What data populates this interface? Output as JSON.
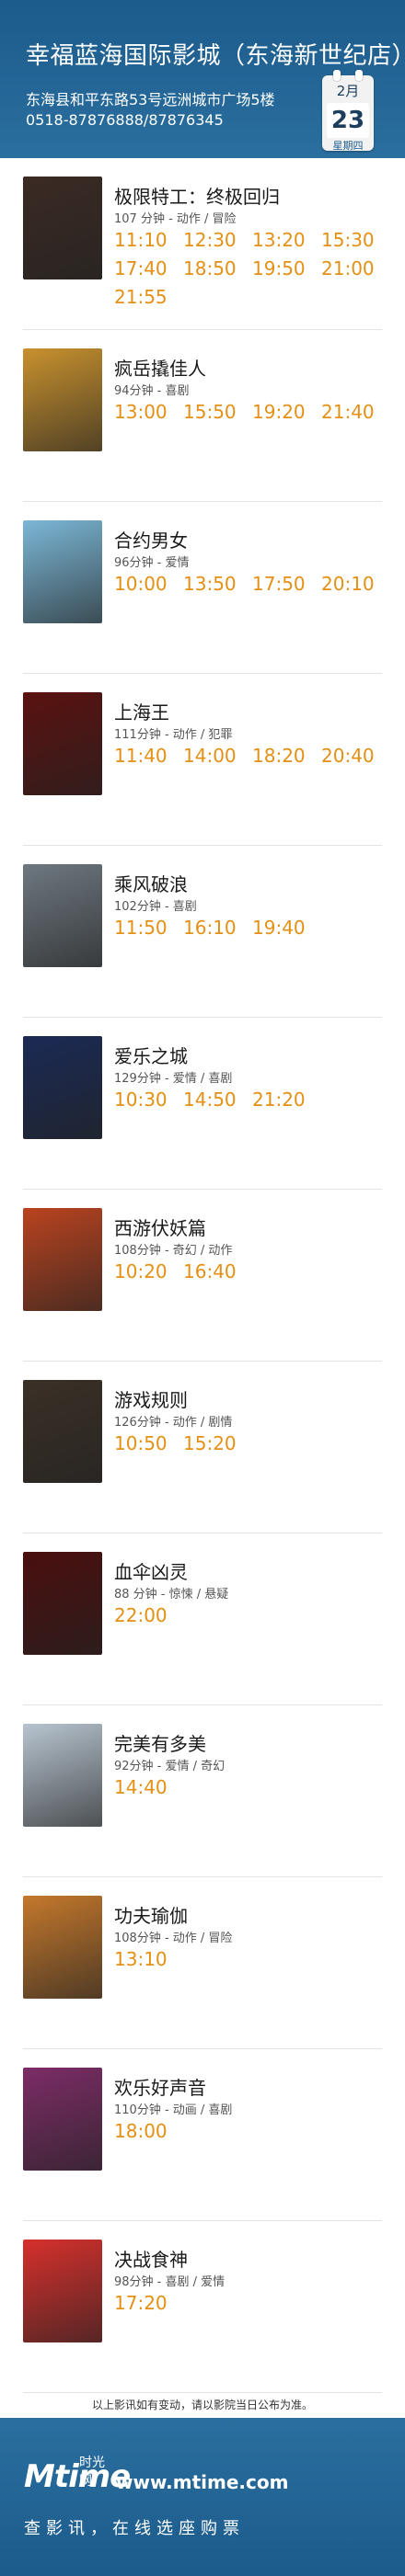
{
  "header": {
    "cinema_name": "幸福蓝海国际影城（东海新世纪店）",
    "address": "东海县和平东路53号远洲城市广场5楼",
    "phone": "0518-87876888/87876345",
    "date": {
      "month": "2月",
      "day": "23",
      "weekday": "星期四"
    }
  },
  "movies": [
    {
      "title": "极限特工：终极回归",
      "meta": "107 分钟 - 动作 / 冒险",
      "times": [
        "11:10",
        "12:30",
        "13:20",
        "15:30",
        "17:40",
        "18:50",
        "19:50",
        "21:00",
        "21:55"
      ],
      "poster_color": "#3b2a23"
    },
    {
      "title": "疯岳撬佳人",
      "meta": "94分钟 - 喜剧",
      "times": [
        "13:00",
        "15:50",
        "19:20",
        "21:40"
      ],
      "poster_color": "#c8912e"
    },
    {
      "title": "合约男女",
      "meta": "96分钟 - 爱情",
      "times": [
        "10:00",
        "13:50",
        "17:50",
        "20:10"
      ],
      "poster_color": "#7bb7d6"
    },
    {
      "title": "上海王",
      "meta": "111分钟 - 动作 / 犯罪",
      "times": [
        "11:40",
        "14:00",
        "18:20",
        "20:40"
      ],
      "poster_color": "#5a1210"
    },
    {
      "title": "乘风破浪",
      "meta": "102分钟 - 喜剧",
      "times": [
        "11:50",
        "16:10",
        "19:40"
      ],
      "poster_color": "#6e7880"
    },
    {
      "title": "爱乐之城",
      "meta": "129分钟 - 爱情 / 喜剧",
      "times": [
        "10:30",
        "14:50",
        "21:20"
      ],
      "poster_color": "#1b2a55"
    },
    {
      "title": "西游伏妖篇",
      "meta": "108分钟 - 奇幻 / 动作",
      "times": [
        "10:20",
        "16:40"
      ],
      "poster_color": "#b9431f"
    },
    {
      "title": "游戏规则",
      "meta": "126分钟 - 动作 / 剧情",
      "times": [
        "10:50",
        "15:20"
      ],
      "poster_color": "#3a3026"
    },
    {
      "title": "血伞凶灵",
      "meta": "88 分钟 - 惊悚 / 悬疑",
      "times": [
        "22:00"
      ],
      "poster_color": "#4a0f0e"
    },
    {
      "title": "完美有多美",
      "meta": "92分钟 - 爱情 / 奇幻",
      "times": [
        "14:40"
      ],
      "poster_color": "#b7c4cf"
    },
    {
      "title": "功夫瑜伽",
      "meta": "108分钟 - 动作 / 冒险",
      "times": [
        "13:10"
      ],
      "poster_color": "#c4782c"
    },
    {
      "title": "欢乐好声音",
      "meta": "110分钟 - 动画 / 喜剧",
      "times": [
        "18:00"
      ],
      "poster_color": "#7c2c66"
    },
    {
      "title": "决战食神",
      "meta": "98分钟 - 喜剧 / 爱情",
      "times": [
        "17:20"
      ],
      "poster_color": "#d6302c"
    }
  ],
  "disclaimer": "以上影讯如有变动，请以影院当日公布为准。",
  "footer": {
    "logo_text": "Mtime",
    "logo_cn": "时光网",
    "url": "www.mtime.com",
    "slogan": "查影讯，在线选座购票"
  }
}
